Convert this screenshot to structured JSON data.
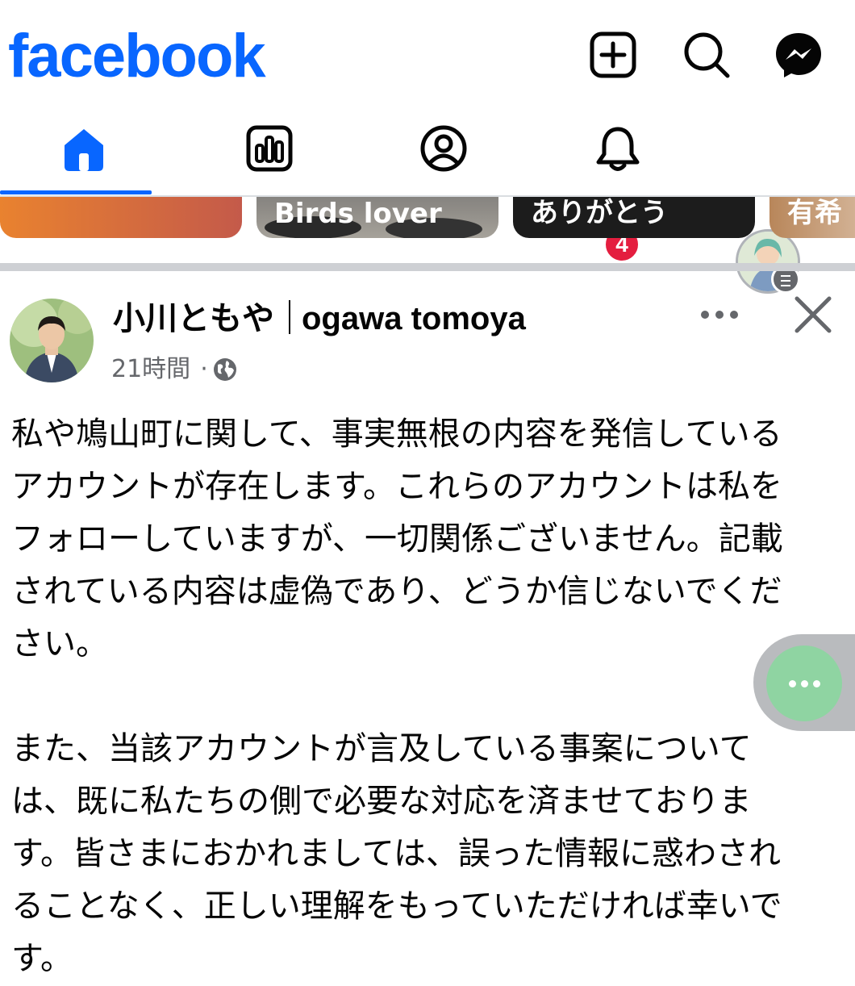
{
  "app": {
    "logo": "facebook",
    "brand_color": "#0866ff"
  },
  "top_actions": [
    {
      "name": "create-post",
      "icon": "plus-square-icon"
    },
    {
      "name": "search",
      "icon": "search-icon"
    },
    {
      "name": "messenger",
      "icon": "messenger-icon"
    }
  ],
  "tabs": [
    {
      "name": "home",
      "icon": "home-icon",
      "active": true
    },
    {
      "name": "reels",
      "icon": "chart-icon",
      "active": false
    },
    {
      "name": "profile",
      "icon": "user-circle-icon",
      "active": false
    },
    {
      "name": "notifications",
      "icon": "bell-icon",
      "active": false,
      "badge": "4"
    },
    {
      "name": "menu",
      "icon": "avatar-menu-icon",
      "active": false
    }
  ],
  "stories": [
    {
      "label": "",
      "style": "orange-gradient"
    },
    {
      "label": "Birds lover",
      "style": "photo-gray"
    },
    {
      "label": "ありがとう",
      "style": "dark"
    },
    {
      "label": "有希",
      "style": "photo-brown"
    }
  ],
  "post": {
    "author_ja": "小川ともや",
    "author_en": "ogawa tomoya",
    "time": "21時間",
    "visibility": "public-globe-icon",
    "body": "私や鳩山町に関して、事実無根の内容を発信している\nアカウントが存在します。これらのアカウントは私を\nフォローしていますが、一切関係ございません。記載\nされている内容は虚偽であり、どうか信じないでくだ\nさい。\n\nまた、当該アカウントが言及している事案について\nは、既に私たちの側で必要な対応を済ませておりま\nす。皆さまにおかれましては、誤った情報に惑わされ\nることなく、正しい理解をもっていただければ幸いで\nす。"
  }
}
